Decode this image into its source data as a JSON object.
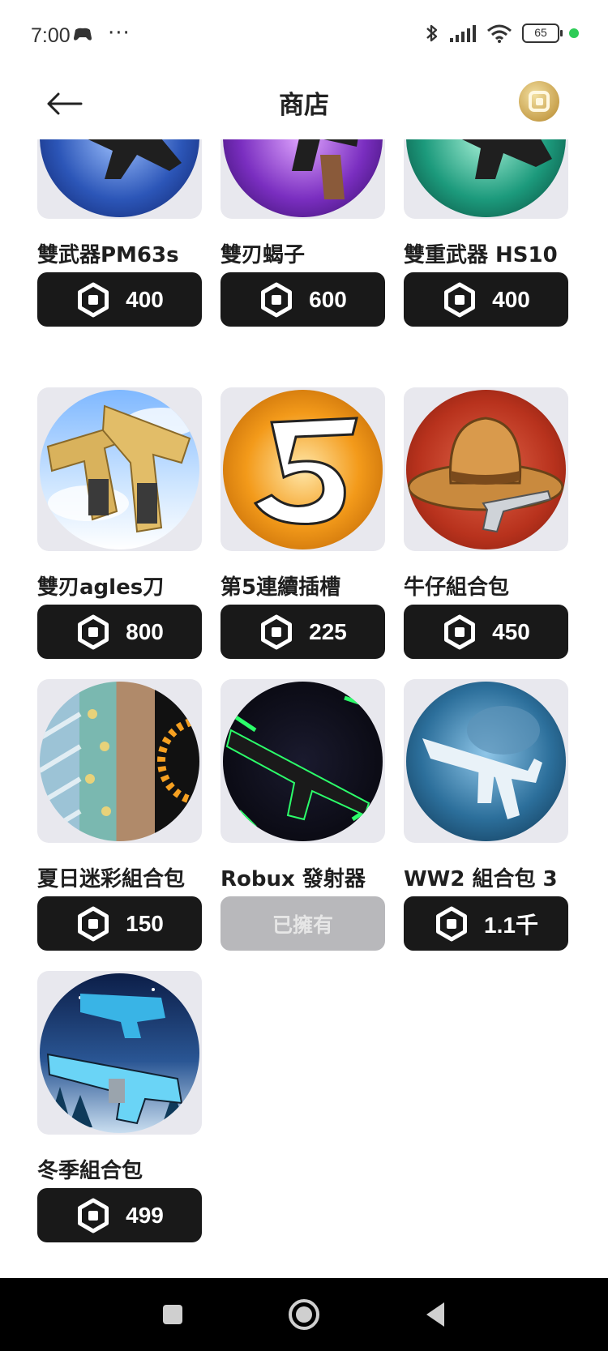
{
  "status_bar": {
    "time": "7:00",
    "more": "···",
    "battery": "65"
  },
  "header": {
    "title": "商店"
  },
  "items": [
    {
      "name": "雙武器PM63s",
      "price": "400"
    },
    {
      "name": "雙刃蝎子",
      "price": "600"
    },
    {
      "name": "雙重武器 HS10",
      "price": "400"
    },
    {
      "name": "雙刃agles刀",
      "price": "800"
    },
    {
      "name": "第5連續插槽",
      "price": "225"
    },
    {
      "name": "牛仔組合包",
      "price": "450"
    },
    {
      "name": "夏日迷彩組合包",
      "price": "150"
    },
    {
      "name": "Robux 發射器",
      "status": "已擁有"
    },
    {
      "name": "WW2 組合包 3",
      "price": "1.1千"
    },
    {
      "name": "冬季組合包",
      "price": "499"
    }
  ],
  "colors": {
    "accent_dark": "#191919",
    "owned_gray": "#b8b8bb",
    "thumb_bg": "#e8e8ee",
    "robux_gold": "#c9a24e"
  },
  "icons": {
    "back": "arrow-left-icon",
    "currency": "robux-icon",
    "nav": [
      "square-icon",
      "circle-icon",
      "triangle-back-icon"
    ]
  }
}
